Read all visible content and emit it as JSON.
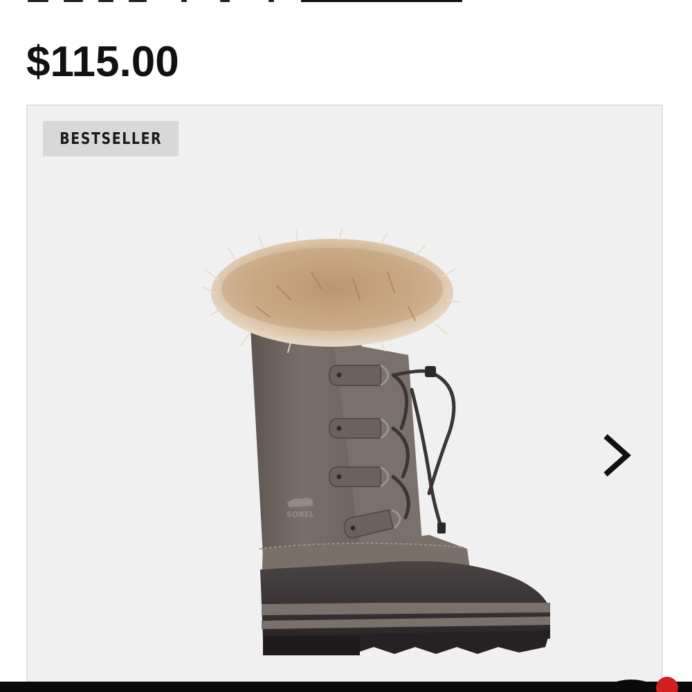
{
  "product": {
    "price": "$115.00",
    "badge": "BESTSELLER"
  },
  "image": {
    "alt": "Sorel Joan of Arctic boot in grey suede with faux fur cuff",
    "brand_mark": "SOREL"
  },
  "icons": {
    "next": "chevron-right-icon"
  },
  "colors": {
    "price_text": "#111111",
    "gallery_bg": "#f0f0f1",
    "badge_bg": "#d8d8d8",
    "boot_suede": "#6f6661",
    "boot_rubber": "#3a3536",
    "fur": "#cdb08f"
  }
}
